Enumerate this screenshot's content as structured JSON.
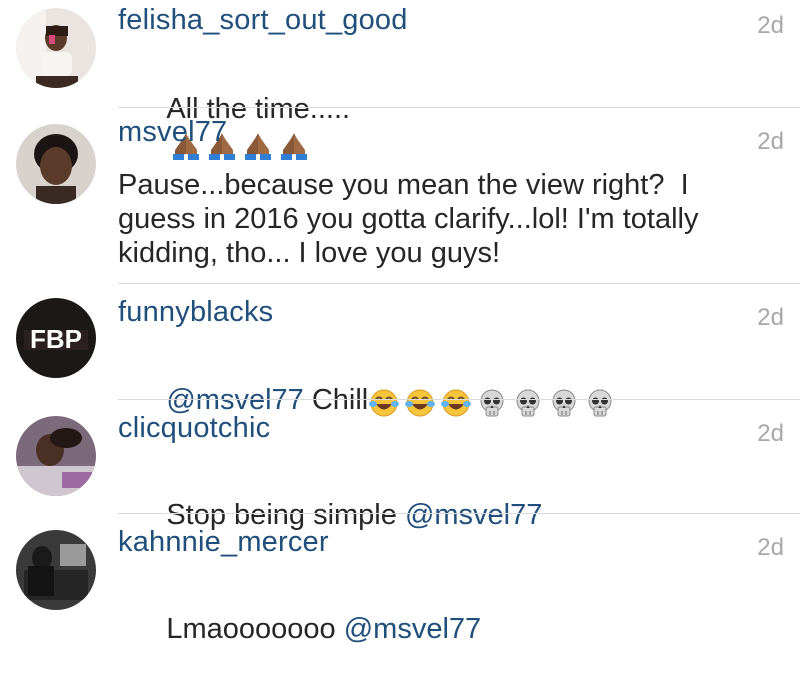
{
  "comments": [
    {
      "username": "felisha_sort_out_good",
      "time": "2d",
      "text": "All the time.....",
      "emojis": [
        "folded-hands-emoji",
        "folded-hands-emoji",
        "folded-hands-emoji",
        "folded-hands-emoji"
      ]
    },
    {
      "username": "msvel77",
      "time": "2d",
      "text": "Pause...because you mean the view right?  I guess in 2016 you gotta clarify...lol! I'm totally kidding, tho... I love you guys!"
    },
    {
      "username": "funnyblacks",
      "time": "2d",
      "mention": "@msvel77",
      "text": " Chill",
      "avatar_text": "FBP",
      "emojis": [
        "tears-of-joy-emoji",
        "tears-of-joy-emoji",
        "tears-of-joy-emoji",
        "skull-emoji",
        "skull-emoji",
        "skull-emoji",
        "skull-emoji"
      ]
    },
    {
      "username": "clicquotchic",
      "time": "2d",
      "text": "Stop being simple ",
      "mention": "@msvel77"
    },
    {
      "username": "kahnnie_mercer",
      "time": "2d",
      "text": "Lmaooooooo ",
      "mention": "@msvel77"
    }
  ],
  "colors": {
    "username": "#1f4f7a",
    "mention": "#1f4f7a",
    "time": "#a8a8a8",
    "text": "#262626",
    "divider": "#dbdbdb"
  }
}
